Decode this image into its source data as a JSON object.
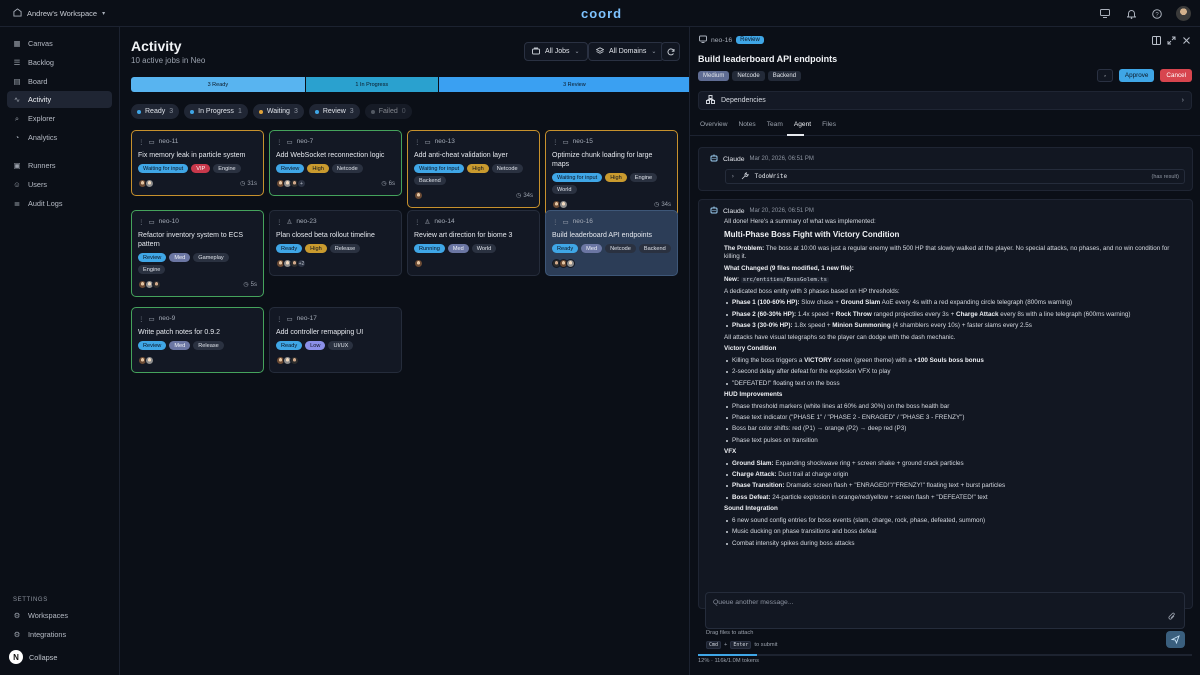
{
  "workspace": {
    "name": "Andrew's Workspace"
  },
  "app": {
    "logo": "coord"
  },
  "sidebar": {
    "items": [
      {
        "label": "Canvas",
        "icon": "canvas-icon"
      },
      {
        "label": "Backlog",
        "icon": "backlog-icon"
      },
      {
        "label": "Board",
        "icon": "board-icon"
      },
      {
        "label": "Activity",
        "icon": "activity-icon",
        "active": true
      },
      {
        "label": "Explorer",
        "icon": "explorer-icon"
      },
      {
        "label": "Analytics",
        "icon": "analytics-icon"
      },
      {
        "label": "Runners",
        "icon": "runners-icon"
      },
      {
        "label": "Users",
        "icon": "users-icon"
      },
      {
        "label": "Audit Logs",
        "icon": "audit-icon"
      }
    ],
    "settings_label": "SETTINGS",
    "settings_items": [
      {
        "label": "Workspaces",
        "icon": "workspaces-icon"
      },
      {
        "label": "Integrations",
        "icon": "integrations-icon"
      }
    ],
    "collapse_label": "Collapse",
    "collapse_logo": "N"
  },
  "main": {
    "title": "Activity",
    "subtitle": "10 active jobs in Neo",
    "jobs_filter": "All Jobs",
    "domains_filter": "All Domains",
    "progress": [
      {
        "label": "3 Ready",
        "fraction": 0.3,
        "color": "#58b4f0"
      },
      {
        "label": "1 In Progress",
        "fraction": 0.23,
        "color": "#2aa1cf"
      },
      {
        "label": "3 Review",
        "fraction": 0.47,
        "color": "#3aa0f2"
      }
    ],
    "filters": [
      {
        "label": "Ready",
        "count": "3",
        "dot": "#3fa6e6"
      },
      {
        "label": "In Progress",
        "count": "1",
        "dot": "#3fa6e6"
      },
      {
        "label": "Waiting",
        "count": "3",
        "dot": "#e0a33a"
      },
      {
        "label": "Review",
        "count": "3",
        "dot": "#3fa6e6"
      },
      {
        "label": "Failed",
        "count": "0",
        "dot": "#8f96a2"
      }
    ],
    "cards": [
      {
        "id": "neo-11",
        "title": "Fix memory leak in particle system",
        "tags": [
          [
            "Waiting for input",
            "wait"
          ],
          [
            "VIP",
            "vip"
          ],
          [
            "Engine",
            "neu"
          ]
        ],
        "time": "31s",
        "status": "amber"
      },
      {
        "id": "neo-7",
        "title": "Add WebSocket reconnection logic",
        "tags": [
          [
            "Review",
            "rev"
          ],
          [
            "High",
            "hi"
          ],
          [
            "Netcode",
            "neu"
          ]
        ],
        "time": "6s",
        "status": "green"
      },
      {
        "id": "neo-13",
        "title": "Add anti-cheat validation layer",
        "tags": [
          [
            "Waiting for input",
            "wait"
          ],
          [
            "High",
            "hi"
          ],
          [
            "Netcode",
            "neu"
          ],
          [
            "Backend",
            "neu"
          ]
        ],
        "time": "34s",
        "status": "amber"
      },
      {
        "id": "neo-15",
        "title": "Optimize chunk loading for large maps",
        "tags": [
          [
            "Waiting for input",
            "wait"
          ],
          [
            "High",
            "hi"
          ],
          [
            "Engine",
            "neu"
          ],
          [
            "World",
            "neu"
          ]
        ],
        "time": "34s",
        "status": "amber"
      },
      {
        "id": "neo-10",
        "title": "Refactor inventory system to ECS pattern",
        "tags": [
          [
            "Review",
            "rev"
          ],
          [
            "Med",
            "med"
          ],
          [
            "Gameplay",
            "neu"
          ],
          [
            "Engine",
            "neu"
          ]
        ],
        "time": "5s",
        "status": "green"
      },
      {
        "id": "neo-23",
        "title": "Plan closed beta rollout timeline",
        "tags": [
          [
            "Ready",
            "ready"
          ],
          [
            "High",
            "hi"
          ],
          [
            "Release",
            "neu"
          ]
        ],
        "time": "",
        "status": "plain",
        "extra": "+2"
      },
      {
        "id": "neo-14",
        "title": "Review art direction for biome 3",
        "tags": [
          [
            "Running",
            "run"
          ],
          [
            "Med",
            "med"
          ],
          [
            "World",
            "neu"
          ]
        ],
        "time": "",
        "status": "plain"
      },
      {
        "id": "neo-16",
        "title": "Build leaderboard API endpoints",
        "tags": [
          [
            "Ready",
            "ready"
          ],
          [
            "Med",
            "med"
          ],
          [
            "Netcode",
            "neu"
          ],
          [
            "Backend",
            "neu"
          ]
        ],
        "time": "",
        "status": "sel"
      },
      {
        "id": "neo-9",
        "title": "Write patch notes for 0.9.2",
        "tags": [
          [
            "Review",
            "rev"
          ],
          [
            "Med",
            "med"
          ],
          [
            "Release",
            "neu"
          ]
        ],
        "time": "",
        "status": "green"
      },
      {
        "id": "neo-17",
        "title": "Add controller remapping UI",
        "tags": [
          [
            "Ready",
            "ready"
          ],
          [
            "Low",
            "low"
          ],
          [
            "UI/UX",
            "neu"
          ]
        ],
        "time": "",
        "status": "plain"
      }
    ]
  },
  "panel": {
    "id": "neo-16",
    "badge": "Review",
    "title": "Build leaderboard API endpoints",
    "tags": [
      "Medium",
      "Netcode",
      "Backend"
    ],
    "approve_label": "Approve",
    "cancel_label": "Cancel",
    "dependencies_label": "Dependencies",
    "tabs": [
      "Overview",
      "Notes",
      "Team",
      "Agent",
      "Files"
    ],
    "active_tab": "Agent",
    "msg1": {
      "author": "Claude",
      "date": "Mar 20, 2026, 06:51 PM",
      "tool": "TodoWrite",
      "tool_result": "(has result)"
    },
    "msg2": {
      "author": "Claude",
      "date": "Mar 20, 2026, 06:51 PM"
    },
    "composer_placeholder": "Queue another message...",
    "drag_hint": "Drag files to attach",
    "submit_keys": [
      "Cmd",
      "Enter"
    ],
    "submit_hint": "to submit",
    "tokens": "12% · 116k/1.0M tokens",
    "token_fraction": 0.12
  }
}
